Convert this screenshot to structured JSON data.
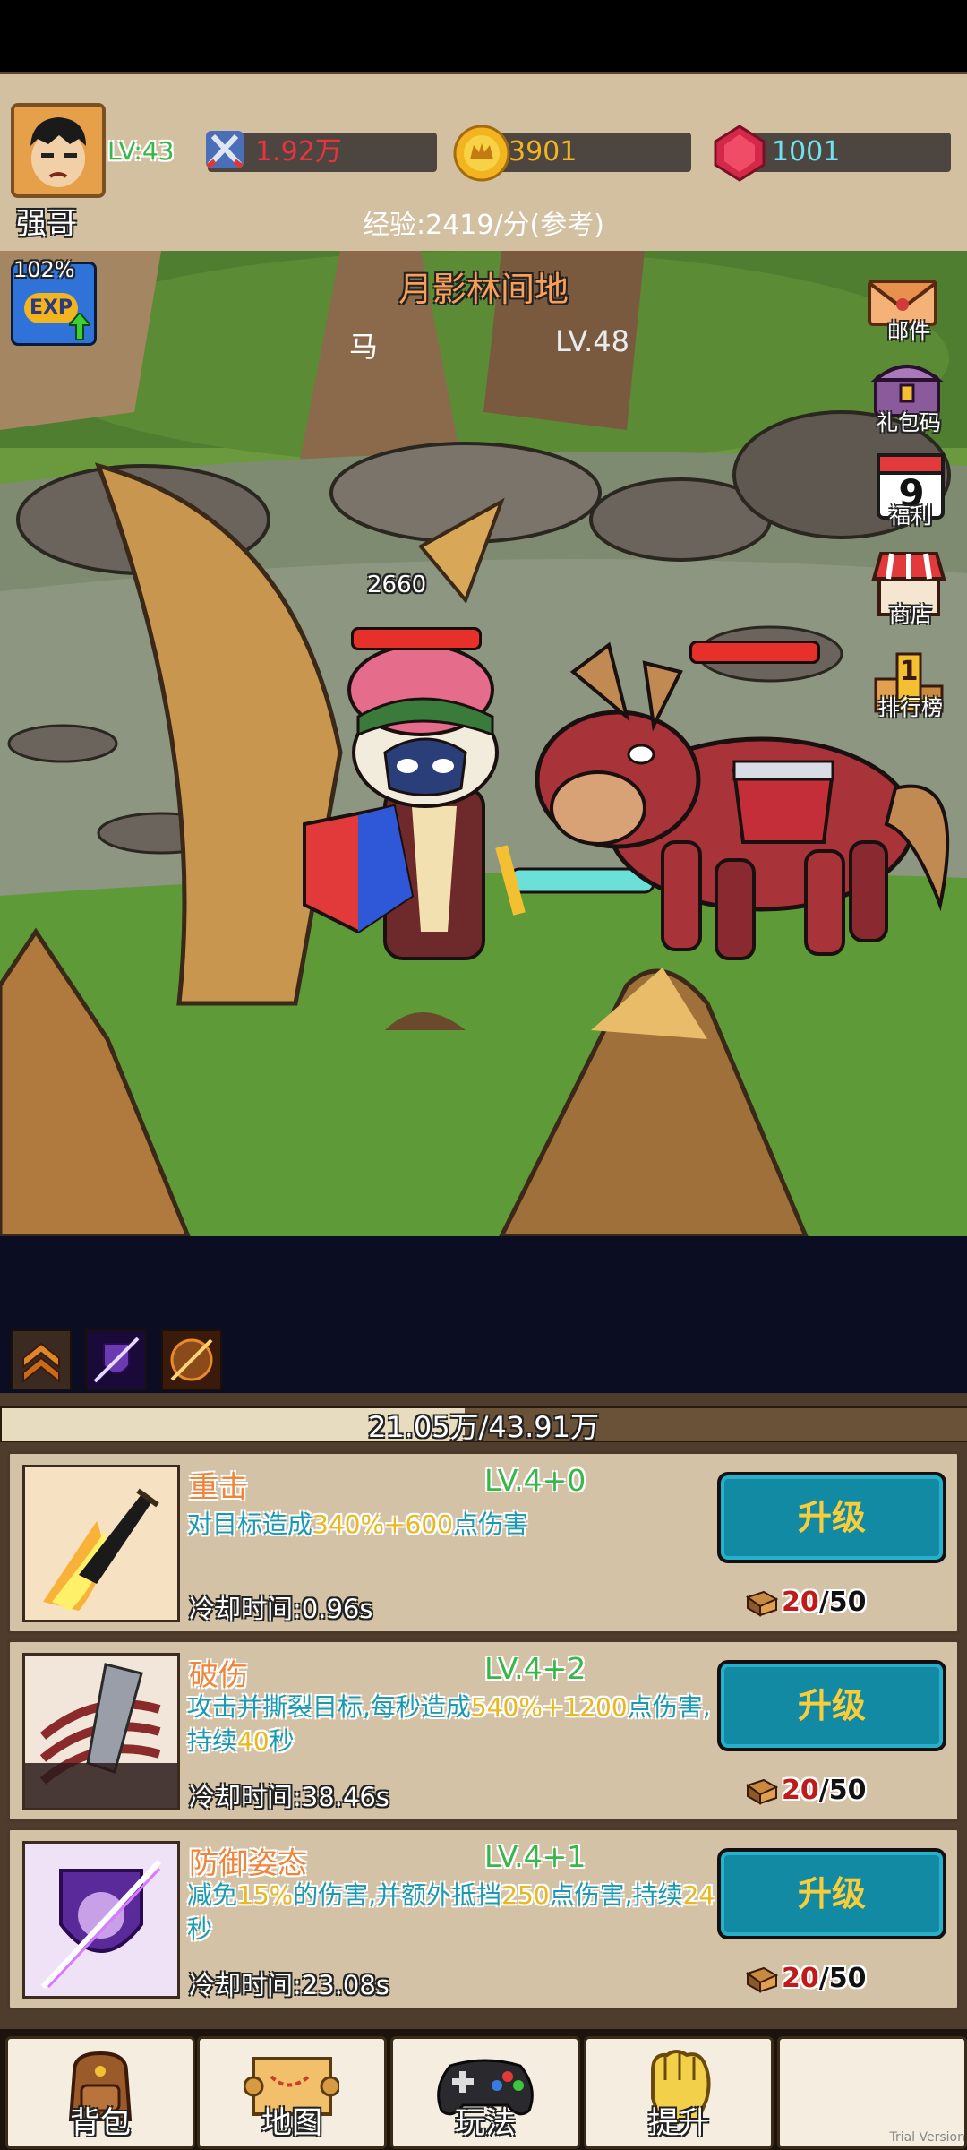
{
  "player": {
    "name": "强哥",
    "level": "LV:43",
    "power": "1.92万",
    "gold": "3901",
    "gems": "1001",
    "exp_rate": "经验:2419/分(参考)",
    "exp_boost": "102%",
    "exp_badge": "EXP"
  },
  "battle": {
    "area_name": "月影林间地",
    "enemy_name": "马",
    "enemy_level": "LV.48",
    "damage_number": "2660",
    "player_hp_fraction": 1.0,
    "enemy_hp_fraction": 1.0
  },
  "side_menu": [
    {
      "label": "邮件",
      "icon": "envelope-icon"
    },
    {
      "label": "礼包码",
      "icon": "treasure-chest-icon"
    },
    {
      "label": "福利",
      "icon": "calendar-icon",
      "badge": "9"
    },
    {
      "label": "商店",
      "icon": "shop-icon"
    },
    {
      "label": "排行榜",
      "icon": "podium-icon",
      "badge": "1"
    }
  ],
  "skill_tabs": [
    "rank-up-icon",
    "purple-slash-icon",
    "fire-slash-icon"
  ],
  "progress": {
    "text": "21.05万/43.91万",
    "fraction": 0.479
  },
  "skills": [
    {
      "name": "重击",
      "level": "LV.4+0",
      "desc_parts": [
        "对目标造成",
        "340%+600",
        "点伤害"
      ],
      "cooldown": "冷却时间:0.96s",
      "button": "升级",
      "cost_have": "20",
      "cost_need": "/50"
    },
    {
      "name": "破伤",
      "level": "LV.4+2",
      "desc_parts": [
        "攻击并撕裂目标,每秒造成",
        "540%+1200",
        "点伤害,持续",
        "40",
        "秒"
      ],
      "cooldown": "冷却时间:38.46s",
      "button": "升级",
      "cost_have": "20",
      "cost_need": "/50"
    },
    {
      "name": "防御姿态",
      "level": "LV.4+1",
      "desc_parts": [
        "减免",
        "15%",
        "的伤害,并额外抵挡",
        "250",
        "点伤害,持续",
        "24",
        "秒"
      ],
      "cooldown": "冷却时间:23.08s",
      "button": "升级",
      "cost_have": "20",
      "cost_need": "/50"
    }
  ],
  "bottom_nav": [
    {
      "label": "背包",
      "icon": "backpack-icon"
    },
    {
      "label": "地图",
      "icon": "map-scroll-icon"
    },
    {
      "label": "玩法",
      "icon": "gamepad-icon"
    },
    {
      "label": "提升",
      "icon": "fist-icon"
    },
    {
      "label": "",
      "icon": ""
    }
  ],
  "watermark": "Trial Version",
  "colors": {
    "level_green": "#39b64a",
    "power_red": "#e8343a",
    "gold_yellow": "#f2b520",
    "gem_cyan": "#6fe3ee",
    "skill_name_orange": "#f0843a",
    "button_teal": "#138aa4",
    "button_text": "#f8cd3a",
    "cost_red": "#c01a1a"
  }
}
